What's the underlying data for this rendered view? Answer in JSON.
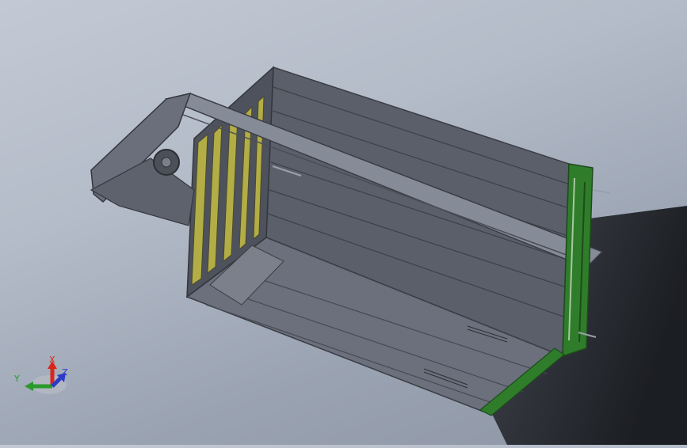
{
  "viewport": {
    "colors": {
      "frame_dark": "#3f434c",
      "frame_mid": "#5c616c",
      "panel_light": "#707683",
      "beam": "#8a909c",
      "yellow_panel": "#b8b24a",
      "green_panel": "#2f7d2a",
      "shadow": "#1a1c20"
    }
  },
  "triad": {
    "x_label": "X",
    "y_label": "Y",
    "z_label": "Z",
    "x_color": "#d9261c",
    "y_color": "#2a9a2a",
    "z_color": "#2a3bc8"
  }
}
